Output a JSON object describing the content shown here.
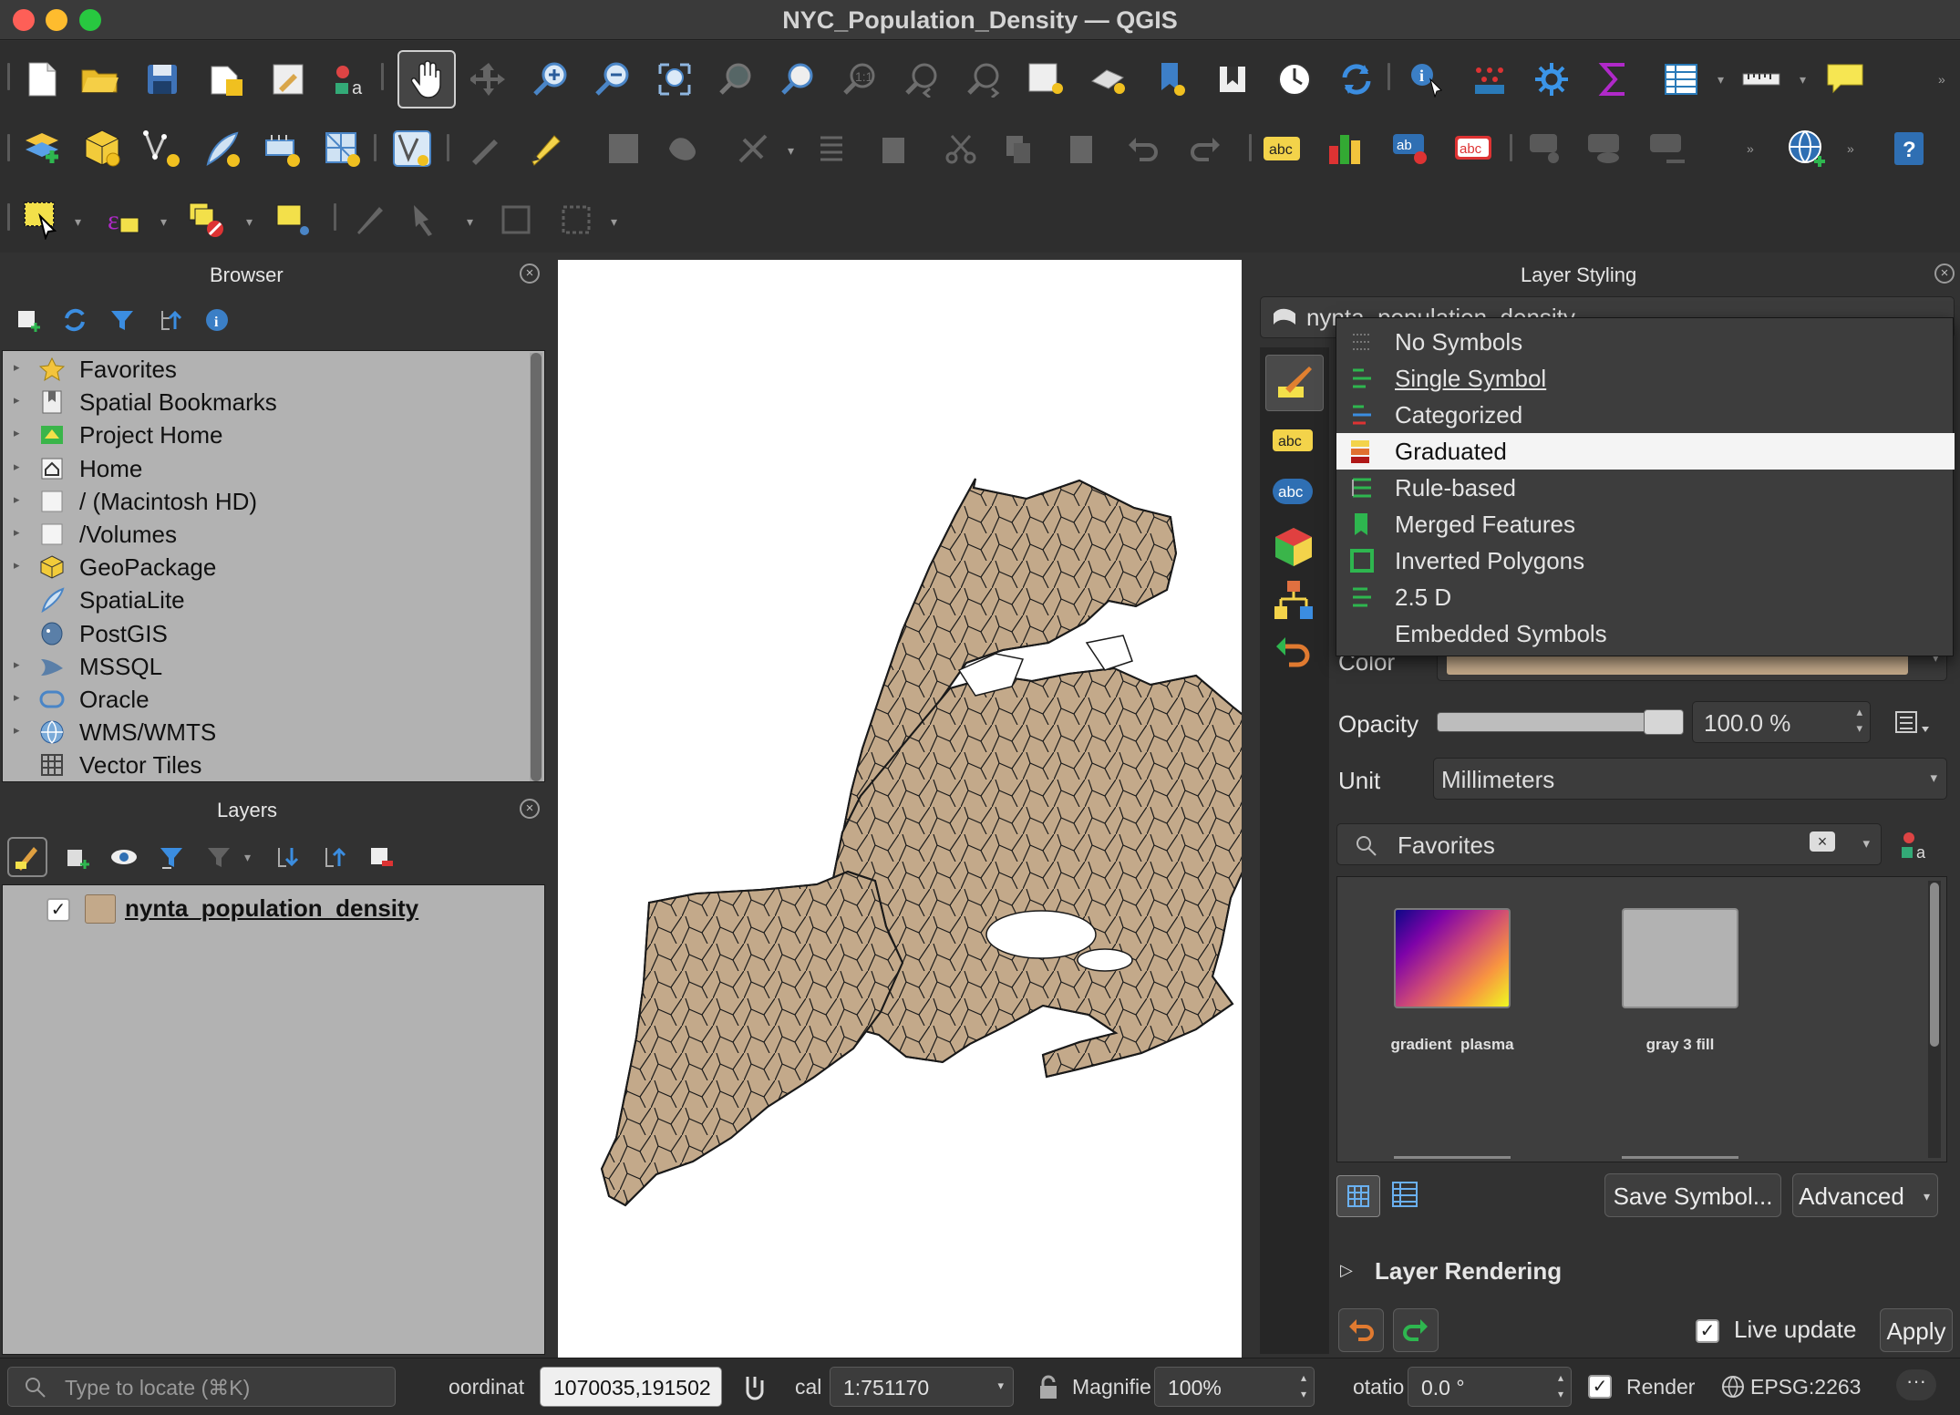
{
  "window": {
    "title": "NYC_Population_Density — QGIS"
  },
  "colors": {
    "polygon_fill": "#c3a98a",
    "polygon_stroke": "#1a1a1a",
    "highlight": "#f4f4f4",
    "accent": "#2ea44f"
  },
  "toolbars": {
    "row1": [
      "new-project-icon",
      "open-project-icon",
      "save-project-icon",
      "save-as-icon",
      "print-layout-icon",
      "style-manager-icon",
      "pan-map-icon",
      "pan-to-selection-icon",
      "zoom-in-icon",
      "zoom-out-icon",
      "zoom-full-icon",
      "zoom-to-selection-icon",
      "zoom-to-layer-icon",
      "zoom-native-icon",
      "zoom-last-icon",
      "zoom-next-icon",
      "new-map-view-icon",
      "new-3d-view-icon",
      "new-bookmark-icon",
      "show-bookmarks-icon",
      "temporal-controller-icon",
      "refresh-icon",
      "identify-features-icon",
      "open-attribute-table-icon",
      "toolbox-icon",
      "statistics-icon",
      "field-calculator-icon",
      "measure-icon",
      "map-tips-icon"
    ],
    "row2": [
      "data-source-manager-icon",
      "new-geopackage-icon",
      "new-shapefile-icon",
      "new-spatialite-icon",
      "new-virtual-layer-icon",
      "new-mesh-icon",
      "digitize-icon",
      "current-edits-icon",
      "toggle-editing-icon",
      "save-edits-icon",
      "add-polygon-icon",
      "vertex-tool-icon",
      "modify-attributes-icon",
      "delete-selected-icon",
      "cut-features-icon",
      "copy-features-icon",
      "paste-features-icon",
      "undo-icon",
      "redo-icon",
      "label-tool-icon",
      "diagram-tool-icon",
      "pin-labels-icon",
      "highlight-labels-icon",
      "show-hide-labels-icon",
      "move-label-icon",
      "rotate-label-icon",
      "change-label-icon",
      "plugins-globe-icon",
      "help-icon"
    ],
    "row3": [
      "select-features-icon",
      "select-by-expression-icon",
      "deselect-all-icon",
      "select-by-location-icon",
      "identify-annotation-icon",
      "text-annotation-icon",
      "move-annotation-icon",
      "rotate-annotation-icon"
    ]
  },
  "browser": {
    "title": "Browser",
    "items": [
      {
        "label": "Favorites",
        "icon": "star-icon",
        "expandable": true
      },
      {
        "label": "Spatial Bookmarks",
        "icon": "bookmark-icon",
        "expandable": true
      },
      {
        "label": "Project Home",
        "icon": "project-home-icon",
        "expandable": true
      },
      {
        "label": "Home",
        "icon": "home-icon",
        "expandable": true
      },
      {
        "label": "/ (Macintosh HD)",
        "icon": "folder-icon",
        "expandable": true
      },
      {
        "label": "/Volumes",
        "icon": "folder-icon",
        "expandable": true
      },
      {
        "label": "GeoPackage",
        "icon": "geopackage-icon",
        "expandable": true
      },
      {
        "label": "SpatiaLite",
        "icon": "spatialite-icon",
        "expandable": false
      },
      {
        "label": "PostGIS",
        "icon": "postgis-icon",
        "expandable": false
      },
      {
        "label": "MSSQL",
        "icon": "mssql-icon",
        "expandable": true
      },
      {
        "label": "Oracle",
        "icon": "oracle-icon",
        "expandable": true
      },
      {
        "label": "WMS/WMTS",
        "icon": "wms-icon",
        "expandable": true
      },
      {
        "label": "Vector Tiles",
        "icon": "vector-tiles-icon",
        "expandable": false
      }
    ]
  },
  "layers": {
    "title": "Layers",
    "items": [
      {
        "name": "nynta_population_density",
        "checked": true,
        "color": "#c3a98a"
      }
    ]
  },
  "styling": {
    "title": "Layer Styling",
    "layer_field": "nynta_population_density",
    "renderer_options": [
      "No Symbols",
      "Single Symbol",
      "Categorized",
      "Graduated",
      "Rule-based",
      "Merged Features",
      "Inverted Polygons",
      "2.5 D",
      "Embedded Symbols"
    ],
    "renderer_current": "Single Symbol",
    "renderer_hovered": "Graduated",
    "color_label": "Color",
    "opacity_label": "Opacity",
    "opacity_value": "100.0 %",
    "opacity_fraction": 1.0,
    "unit_label": "Unit",
    "unit_value": "Millimeters",
    "symbol_search": "Favorites",
    "symbols": [
      {
        "name": "gradient  plasma"
      },
      {
        "name": "gray 3 fill"
      }
    ],
    "save_symbol": "Save Symbol...",
    "advanced": "Advanced",
    "layer_rendering": "Layer Rendering",
    "live_update": "Live update",
    "live_update_checked": true,
    "apply": "Apply"
  },
  "status": {
    "locate_placeholder": "Type to locate (⌘K)",
    "coordinate_label": "oordinat",
    "coordinate_value": "1070035,191502",
    "scale_label": "cal",
    "scale_value": "1:751170",
    "magnifier_label": "Magnifie",
    "magnifier_value": "100%",
    "rotation_label": "otatio",
    "rotation_value": "0.0 °",
    "render_label": "Render",
    "render_checked": true,
    "crs": "EPSG:2263"
  }
}
